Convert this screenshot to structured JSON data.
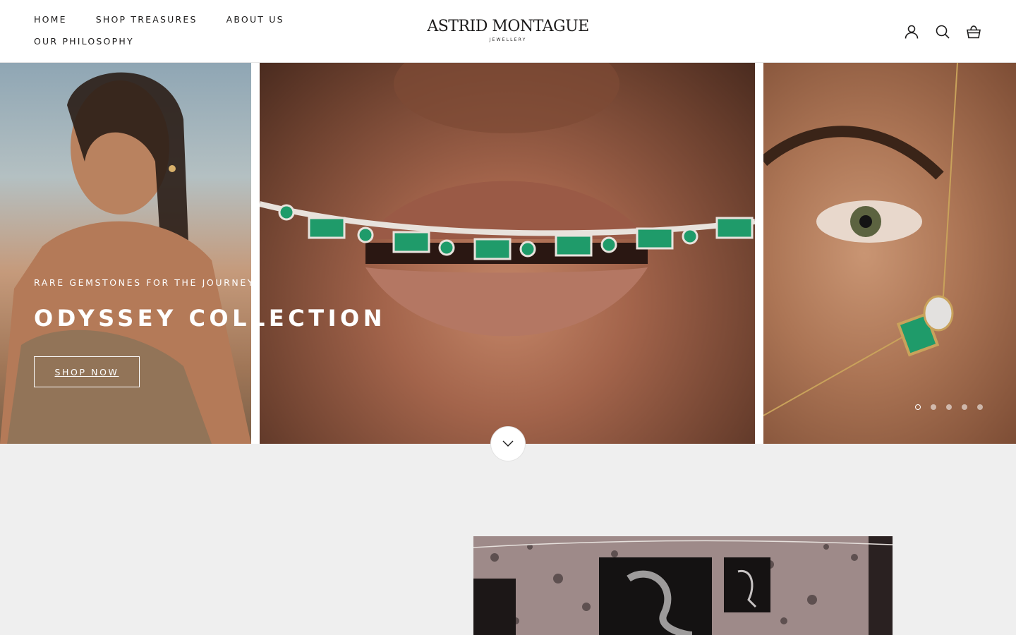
{
  "header": {
    "nav": [
      {
        "label": "HOME"
      },
      {
        "label": "SHOP TREASURES"
      },
      {
        "label": "ABOUT US"
      },
      {
        "label": "OUR PHILOSOPHY"
      }
    ],
    "logo": {
      "name": "ASTRID MONTAGUE",
      "tagline": "JEWELLERY"
    },
    "icons": [
      "account-icon",
      "search-icon",
      "cart-icon"
    ]
  },
  "hero": {
    "eyebrow": "RARE GEMSTONES FOR THE JOURNEY",
    "title": "ODYSSEY COLLECTION",
    "cta": "SHOP NOW",
    "slides_total": 5,
    "active_slide": 1
  },
  "colors": {
    "text": "#1c1b1b",
    "background": "#efefef",
    "header": "#ffffff",
    "emerald": "#1f9b6a",
    "gold": "#c9a25b"
  }
}
